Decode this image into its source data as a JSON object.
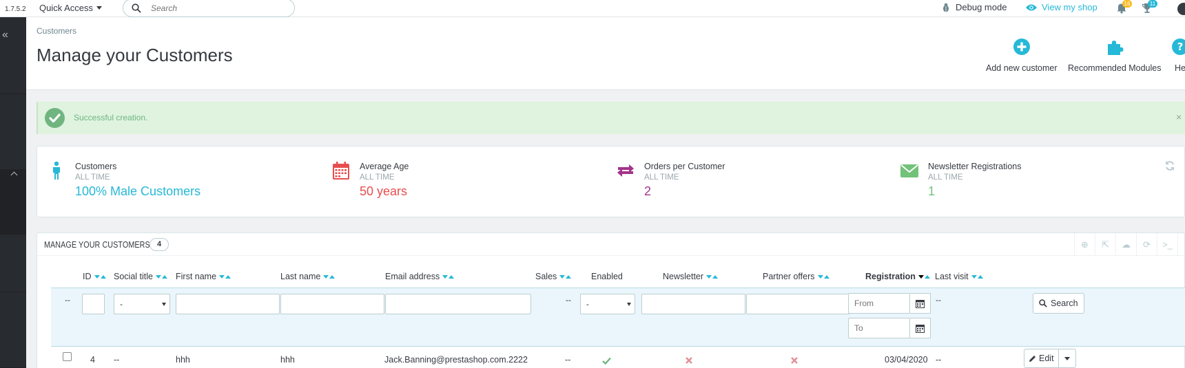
{
  "header": {
    "version": "1.7.5.2",
    "quick_access": "Quick Access",
    "search_placeholder": "Search",
    "debug_mode": "Debug mode",
    "view_shop": "View my shop",
    "notif_orders": "16",
    "notif_customers": "11"
  },
  "page": {
    "breadcrumb": "Customers",
    "title": "Manage your Customers",
    "toolbar": {
      "add_new": "Add new customer",
      "recommended": "Recommended Modules",
      "help": "He"
    }
  },
  "alert": {
    "message": "Successful creation."
  },
  "kpis": [
    {
      "title": "Customers",
      "subtitle": "ALL TIME",
      "value": "100% Male Customers",
      "icon": "male-icon",
      "color": "#25b9d7"
    },
    {
      "title": "Average Age",
      "subtitle": "ALL TIME",
      "value": "50 years",
      "icon": "calendar-icon",
      "color": "#e84e4e"
    },
    {
      "title": "Orders per Customer",
      "subtitle": "ALL TIME",
      "value": "2",
      "icon": "exchange-icon",
      "color": "#a3338b"
    },
    {
      "title": "Newsletter Registrations",
      "subtitle": "ALL TIME",
      "value": "1",
      "icon": "envelope-icon",
      "color": "#72c279"
    }
  ],
  "panel": {
    "title": "Manage your Customers",
    "count": "4",
    "columns": {
      "id": "ID",
      "social_title": "Social title",
      "first_name": "First name",
      "last_name": "Last name",
      "email": "Email address",
      "sales": "Sales",
      "enabled": "Enabled",
      "newsletter": "Newsletter",
      "partner_offers": "Partner offers",
      "registration": "Registration",
      "last_visit": "Last visit"
    },
    "filters": {
      "dash": "--",
      "select_default": "-",
      "from_placeholder": "From",
      "to_placeholder": "To",
      "search_label": "Search"
    },
    "rows": [
      {
        "id": "4",
        "social_title": "--",
        "first_name": "hhh",
        "last_name": "hhh",
        "email": "Jack.Banning@prestashop.com.2222",
        "sales": "--",
        "registration": "03/04/2020",
        "last_visit": "--",
        "edit_label": "Edit"
      }
    ]
  }
}
